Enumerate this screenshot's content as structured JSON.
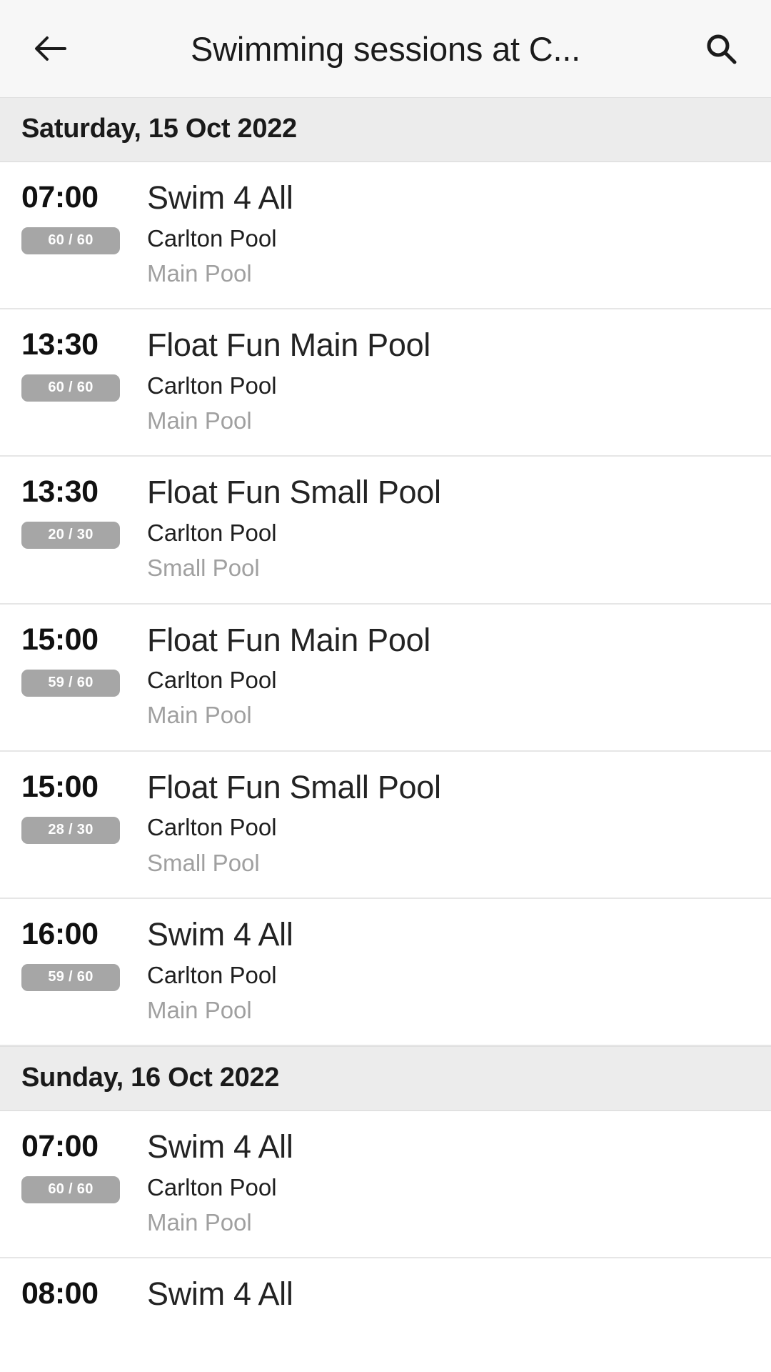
{
  "appbar": {
    "back_icon": "arrow-left-icon",
    "title": "Swimming sessions at C...",
    "search_icon": "search-icon"
  },
  "colors": {
    "appbar_bg": "#f7f7f7",
    "day_header_bg": "#ececec",
    "badge_bg": "#a6a6a6",
    "badge_text": "#ffffff",
    "title_text": "#232323",
    "muted_text": "#a0a0a0",
    "divider": "#e6e6e6"
  },
  "days": [
    {
      "date_label": "Saturday, 15 Oct 2022",
      "sessions": [
        {
          "time": "07:00",
          "capacity": "60 / 60",
          "title": "Swim 4 All",
          "venue": "Carlton Pool",
          "area": "Main Pool"
        },
        {
          "time": "13:30",
          "capacity": "60 / 60",
          "title": "Float Fun Main Pool",
          "venue": "Carlton Pool",
          "area": "Main Pool"
        },
        {
          "time": "13:30",
          "capacity": "20 / 30",
          "title": "Float Fun Small Pool",
          "venue": "Carlton Pool",
          "area": "Small Pool"
        },
        {
          "time": "15:00",
          "capacity": "59 / 60",
          "title": "Float Fun Main Pool",
          "venue": "Carlton Pool",
          "area": "Main Pool"
        },
        {
          "time": "15:00",
          "capacity": "28 / 30",
          "title": "Float Fun Small Pool",
          "venue": "Carlton Pool",
          "area": "Small Pool"
        },
        {
          "time": "16:00",
          "capacity": "59 / 60",
          "title": "Swim 4 All",
          "venue": "Carlton Pool",
          "area": "Main Pool"
        }
      ]
    },
    {
      "date_label": "Sunday, 16 Oct 2022",
      "sessions": [
        {
          "time": "07:00",
          "capacity": "60 / 60",
          "title": "Swim 4 All",
          "venue": "Carlton Pool",
          "area": "Main Pool"
        },
        {
          "time": "08:00",
          "capacity": "",
          "title": "Swim 4 All",
          "venue": "",
          "area": ""
        }
      ]
    }
  ]
}
